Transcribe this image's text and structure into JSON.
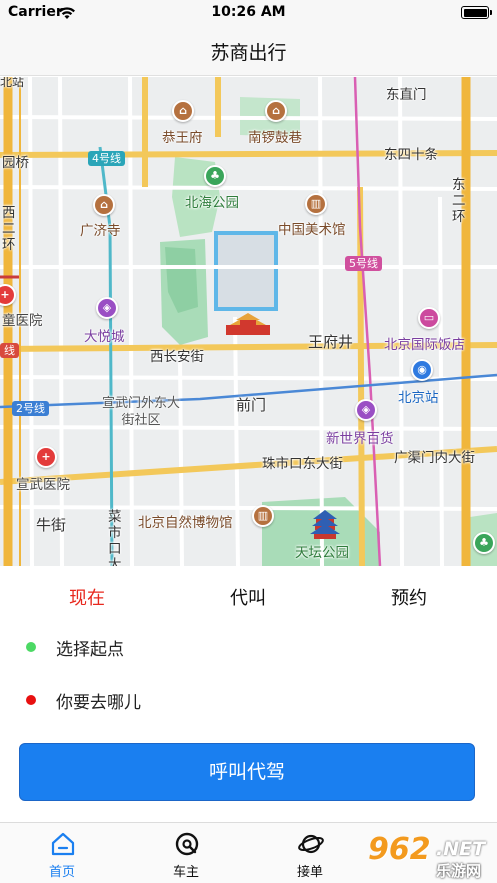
{
  "status_bar": {
    "carrier": "Carrier",
    "time": "10:26 AM"
  },
  "nav": {
    "title": "苏商出行"
  },
  "map": {
    "labels": {
      "dongzhimen": "东直门",
      "gongwangfu": "恭王府",
      "nanluoguxiang": "南锣鼓巷",
      "dongsishitiao": "东四十条",
      "yuanqiao": "园桥",
      "line4": "4号线",
      "beihai": "北海公园",
      "guangjisi": "广济寺",
      "meishuguan": "中国美术馆",
      "xierhuan": "西二环",
      "dongerhuan": "东二环",
      "line5": "5号线",
      "tongyiyuan": "童医院",
      "dayuecheng": "大悦城",
      "wangfujing": "王府井",
      "guojifandian": "北京国际饭店",
      "xichanganjie": "西长安街",
      "line1": "线",
      "line2": "2号线",
      "xuanwumen": "宣武门外东大街社区",
      "qianmen": "前门",
      "beijingzhan": "北京站",
      "xinshijie": "新世界百货",
      "guangqumen": "广渠门内大街",
      "xuanwuyiyuan": "宣武医院",
      "zhushikou": "珠市口东大街",
      "niujie": "牛街",
      "caishikou": "菜市口大",
      "ziranbowuguan": "北京自然博物馆",
      "tiantan": "天坛公园",
      "beizhan": "北站"
    }
  },
  "tabs": {
    "now": "现在",
    "proxy": "代叫",
    "reserve": "预约"
  },
  "form": {
    "start": "选择起点",
    "destination": "你要去哪儿"
  },
  "call_button": "呼叫代驾",
  "tabbar": {
    "home": "首页",
    "owner": "车主",
    "orders": "接单"
  },
  "watermark": {
    "num": "962",
    "net": ".NET",
    "cn": "乐游网"
  },
  "colors": {
    "accent_red": "#e8281e",
    "primary_blue": "#1a7ff0",
    "dot_green": "#4cd964",
    "dot_red": "#e81010"
  }
}
